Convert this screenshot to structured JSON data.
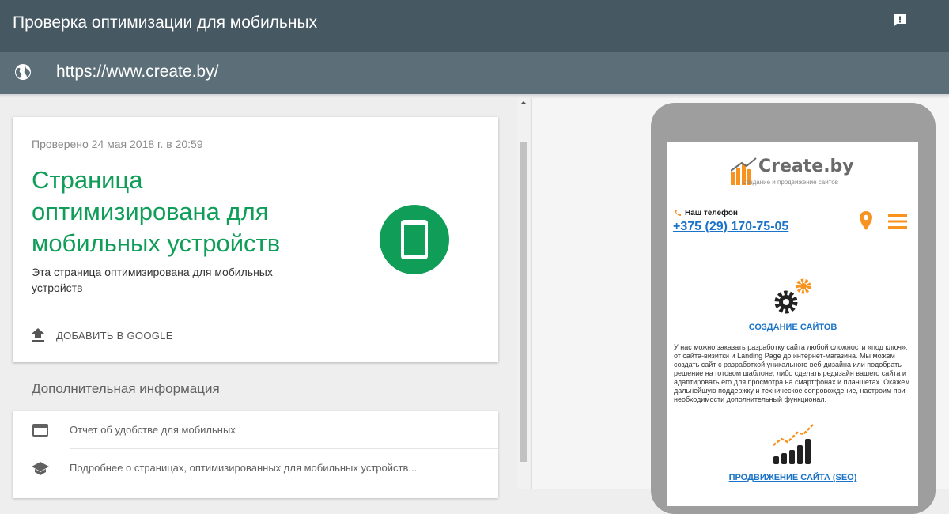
{
  "header": {
    "title": "Проверка оптимизации для мобильных",
    "feedback_icon": "feedback-icon"
  },
  "urlbar": {
    "globe_icon": "globe-icon",
    "url": "https://www.create.by/"
  },
  "result_card": {
    "checked_at": "Проверено 24 мая 2018 г. в 20:59",
    "title": "Страница оптимизирована для мобильных устройств",
    "description": "Эта страница оптимизирована для мобильных устройств",
    "add_button_label": "ДОБАВИТЬ В GOOGLE",
    "status_color": "#0f9d58",
    "badge_icon": "mobile-phone-icon"
  },
  "additional": {
    "title": "Дополнительная информация",
    "items": [
      {
        "icon": "web-report-icon",
        "label": "Отчет об удобстве для мобильных"
      },
      {
        "icon": "school-icon",
        "label": "Подробнее о страницах, оптимизированных для мобильных устройств..."
      }
    ]
  },
  "preview": {
    "logo_text": "Create.by",
    "logo_sub": "Создание и продвижение сайтов",
    "phone_label": "Наш телефон",
    "phone_number": "+375 (29) 170-75-05",
    "service1_title": "СОЗДАНИЕ САЙТОВ",
    "service1_text": "У нас можно заказать разработку сайта любой сложности «под ключ»: от сайта-визитки и Landing Page до интернет-магазина. Мы можем создать сайт с разработкой уникального веб-дизайна или подобрать решение на готовом шаблоне, либо сделать редизайн вашего сайта и адаптировать его для просмотра на смартфонах и планшетах. Окажем дальнейшую поддержку и техническое сопровождение, настроим при необходимости дополнительный функционал.",
    "service2_title": "ПРОДВИЖЕНИЕ САЙТА (SEO)",
    "accent_color": "#f7931e",
    "link_color": "#1a73c7"
  }
}
